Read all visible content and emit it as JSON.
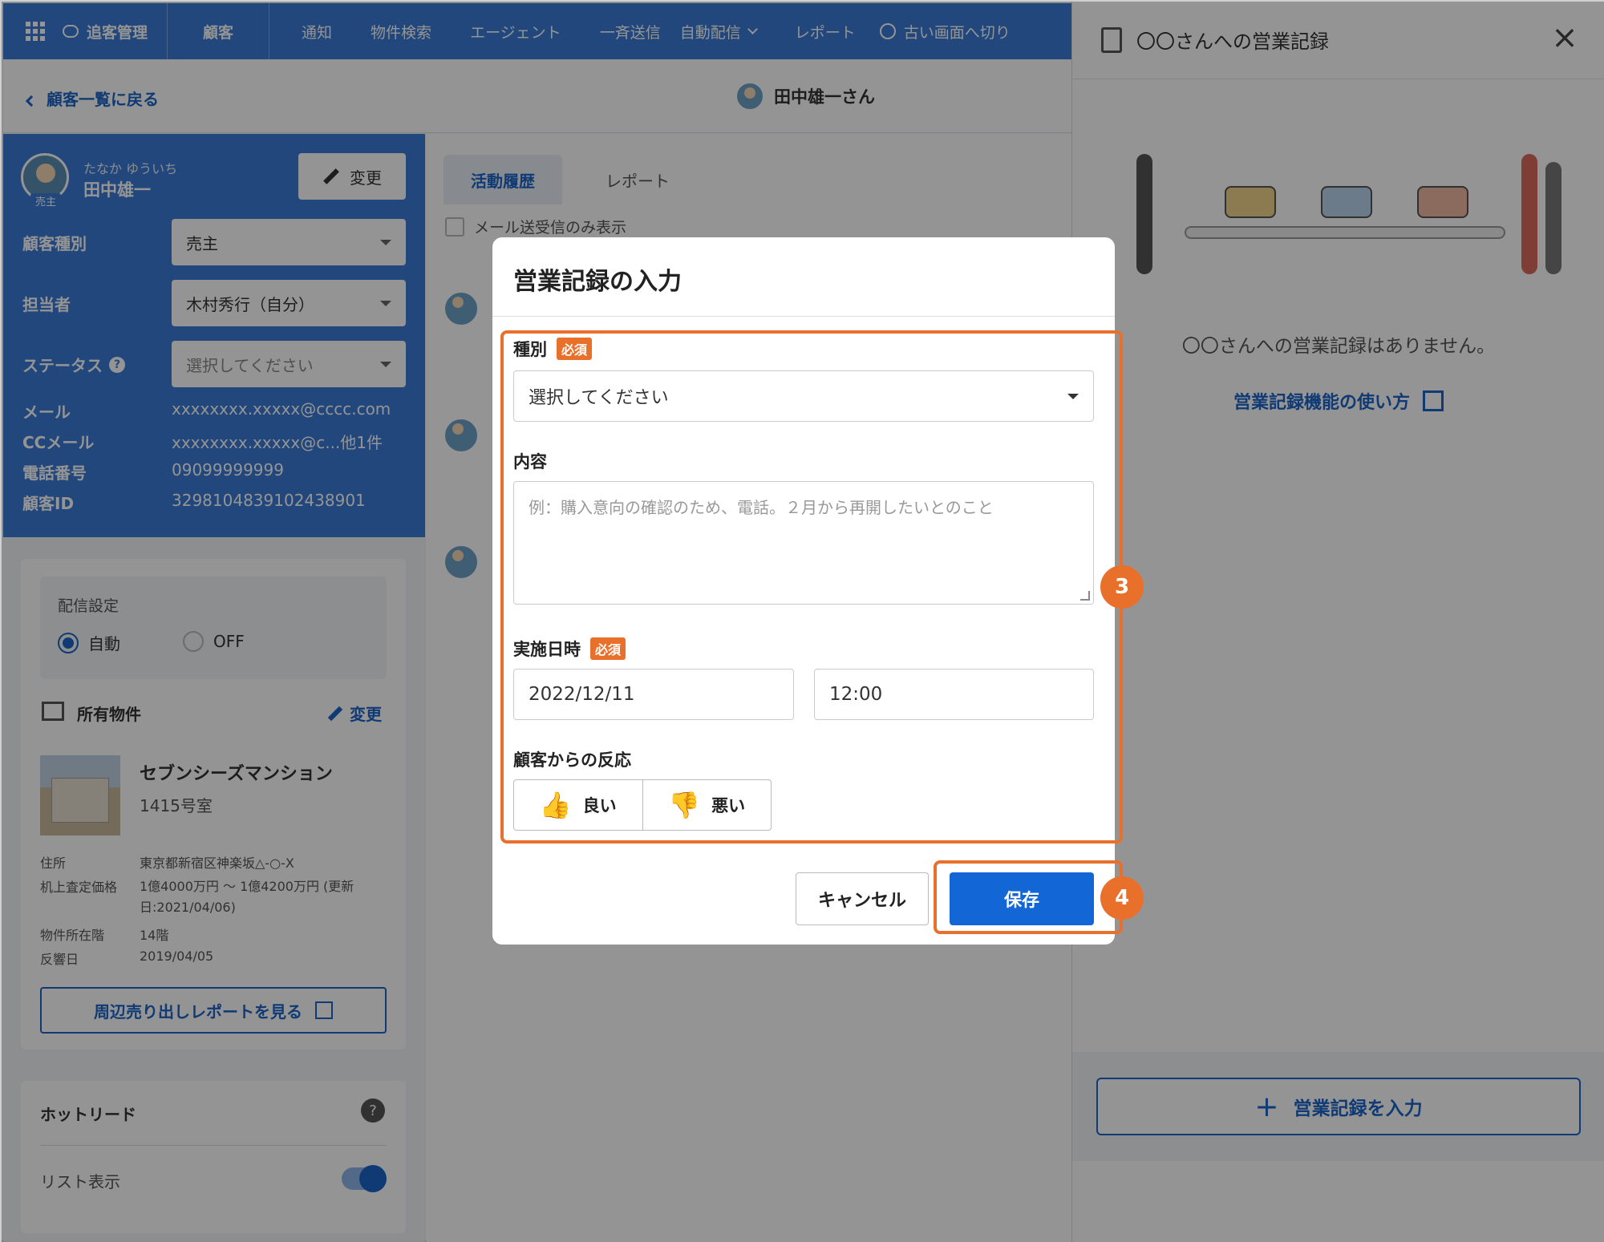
{
  "nav": {
    "brand": "追客管理",
    "items": [
      "顧客",
      "通知",
      "物件検索",
      "エージェント",
      "一斉送信",
      "自動配信",
      "レポート",
      "古い画面へ切り"
    ]
  },
  "breadcrumb": {
    "back": "顧客一覧に戻る",
    "customer_name": "田中雄一さん"
  },
  "profile": {
    "kana": "たなか ゆういち",
    "name": "田中雄一",
    "role_badge": "売主",
    "edit": "変更",
    "fields": [
      {
        "label": "顧客種別",
        "value": "売主"
      },
      {
        "label": "担当者",
        "value": "木村秀行（自分）"
      },
      {
        "label": "ステータス",
        "value": "選択してください"
      }
    ],
    "info": [
      {
        "label": "メール",
        "value": "xxxxxxxx.xxxxx@cccc.com"
      },
      {
        "label": "CCメール",
        "value": "xxxxxxxx.xxxxx@c...他1件"
      },
      {
        "label": "電話番号",
        "value": "09099999999"
      },
      {
        "label": "顧客ID",
        "value": "329810483910243890​1"
      }
    ]
  },
  "delivery": {
    "title": "配信設定",
    "auto": "自動",
    "off": "OFF"
  },
  "property": {
    "section": "所有物件",
    "edit": "変更",
    "name": "セブンシーズマンション",
    "room": "1415号室",
    "details": [
      {
        "label": "住所",
        "value": "東京都新宿区神楽坂△-○-X"
      },
      {
        "label": "机上査定価格",
        "value": "1億4000万円 〜 1億4200万円 (更新日:2021/04/06)"
      },
      {
        "label": "物件所在階",
        "value": "14階"
      },
      {
        "label": "反響日",
        "value": "2019/04/05"
      }
    ],
    "report_link": "周辺売り出しレポートを見る"
  },
  "hotlead": {
    "title": "ホットリード",
    "list": "リスト表示"
  },
  "middle": {
    "tabs": [
      "活動履歴",
      "レポート"
    ],
    "filter": "メール送受信のみ表示"
  },
  "right_panel": {
    "title": "〇〇さんへの営業記録",
    "empty": "〇〇さんへの営業記録はありません。",
    "help_link": "営業記録機能の使い方",
    "add_button": "営業記録を入力"
  },
  "modal": {
    "title": "営業記録の入力",
    "type_label": "種別",
    "required": "必須",
    "type_placeholder": "選択してください",
    "content_label": "内容",
    "content_placeholder": "例：購入意向の確認のため、電話。２月から再開したいとのこと",
    "datetime_label": "実施日時",
    "date_value": "2022/12/11",
    "time_value": "12:00",
    "reaction_label": "顧客からの反応",
    "good": "良い",
    "bad": "悪い",
    "cancel": "キャンセル",
    "save": "保存"
  },
  "callouts": {
    "step3": "3",
    "step4": "4"
  },
  "colors": {
    "brand": "#3a7ad6",
    "accent": "#e8702a",
    "primary_button": "#1266d6"
  }
}
